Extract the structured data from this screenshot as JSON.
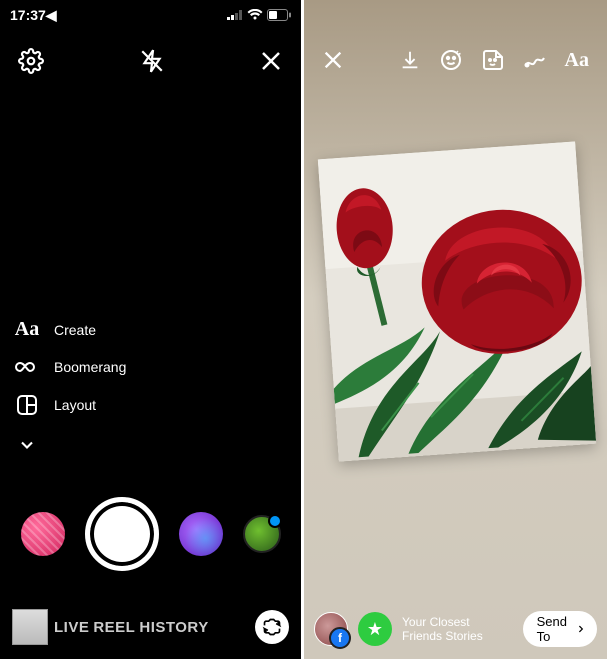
{
  "status": {
    "time": "17:37◀"
  },
  "left": {
    "modes": {
      "create": "Create",
      "boomerang": "Boomerang",
      "layout": "Layout"
    },
    "tabs": {
      "live": "LIVE",
      "reel": "REEL",
      "history": "HISTORY"
    }
  },
  "right": {
    "text_tool": "Aa",
    "share": {
      "your": "Your",
      "closest": "Closest Friends",
      "stories": "Stories",
      "send_to": "Send To"
    }
  }
}
